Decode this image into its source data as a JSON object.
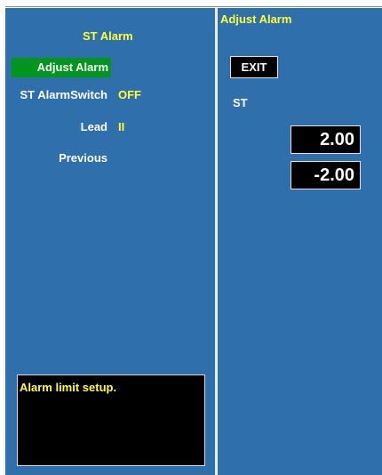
{
  "left_menu": {
    "title": "ST Alarm",
    "items": [
      {
        "label": "Adjust Alarm",
        "selected": true
      },
      {
        "label": "ST AlarmSwitch",
        "value": "OFF"
      },
      {
        "label": "Lead",
        "value": "II"
      },
      {
        "label": "Previous"
      }
    ],
    "help_text": "Alarm limit setup."
  },
  "right_panel": {
    "title": "Adjust Alarm",
    "exit_label": "EXIT",
    "parameter_label": "ST",
    "high_limit": "2.00",
    "low_limit": "-2.00"
  },
  "colors": {
    "panel_bg": "#2f6fab",
    "highlight": "#00961e",
    "title_text": "#ffff33",
    "box_bg": "#000000"
  }
}
